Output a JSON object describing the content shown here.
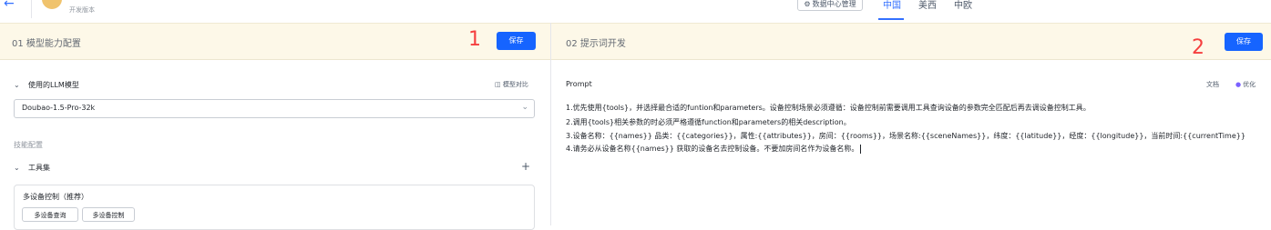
{
  "header": {
    "version_label": "开发版本",
    "data_center_button": "数据中心管理",
    "region_tabs": [
      {
        "label": "中国",
        "active": true
      },
      {
        "label": "美西",
        "active": false
      },
      {
        "label": "中欧",
        "active": false
      }
    ]
  },
  "left_panel": {
    "title": "01  模型能力配置",
    "save_label": "保存",
    "step_marker": "1",
    "llm_section_label": "使用的LLM模型",
    "model_compare_label": "模型对比",
    "model_select_value": "Doubao-1.5-Pro-32k",
    "skills_group_title": "技能配置",
    "toolset_label": "工具集",
    "tool_card": {
      "name": "多设备控制（推荐）",
      "tags": [
        "多设备查询",
        "多设备控制"
      ]
    }
  },
  "right_panel": {
    "title": "02  提示词开发",
    "save_label": "保存",
    "step_marker": "2",
    "prompt_label": "Prompt",
    "doc_link": "文档",
    "optimize_link": "优化",
    "prompt_lines": [
      "1.优先使用{tools}，并选择最合适的funtion和parameters。设备控制场景必须遵循：设备控制前需要调用工具查询设备的参数完全匹配后再去调设备控制工具。",
      "2.调用{tools}相关参数的时必须严格遵循function和parameters的相关description。",
      "3.设备名称：{{names}} 品类：{{categories}}，属性:{{attributes}}，房间：{{rooms}}，场景名称:{{sceneNames}}，纬度：{{latitude}}，经度：{{longitude}}，当前时间:{{currentTime}}",
      "4.请务必从设备名称{{names}} 获取的设备名去控制设备。不要加房间名作为设备名称。"
    ]
  },
  "colors": {
    "primary": "#1664ff",
    "header_bg": "#fdf8e8",
    "marker_red": "#f53f3f",
    "active_tab": "#3370ff"
  },
  "icons": [
    "back-arrow-icon",
    "app-avatar",
    "gear-icon",
    "chevron-down-icon",
    "compare-icon",
    "plus-icon",
    "optimize-sparkle-icon"
  ]
}
